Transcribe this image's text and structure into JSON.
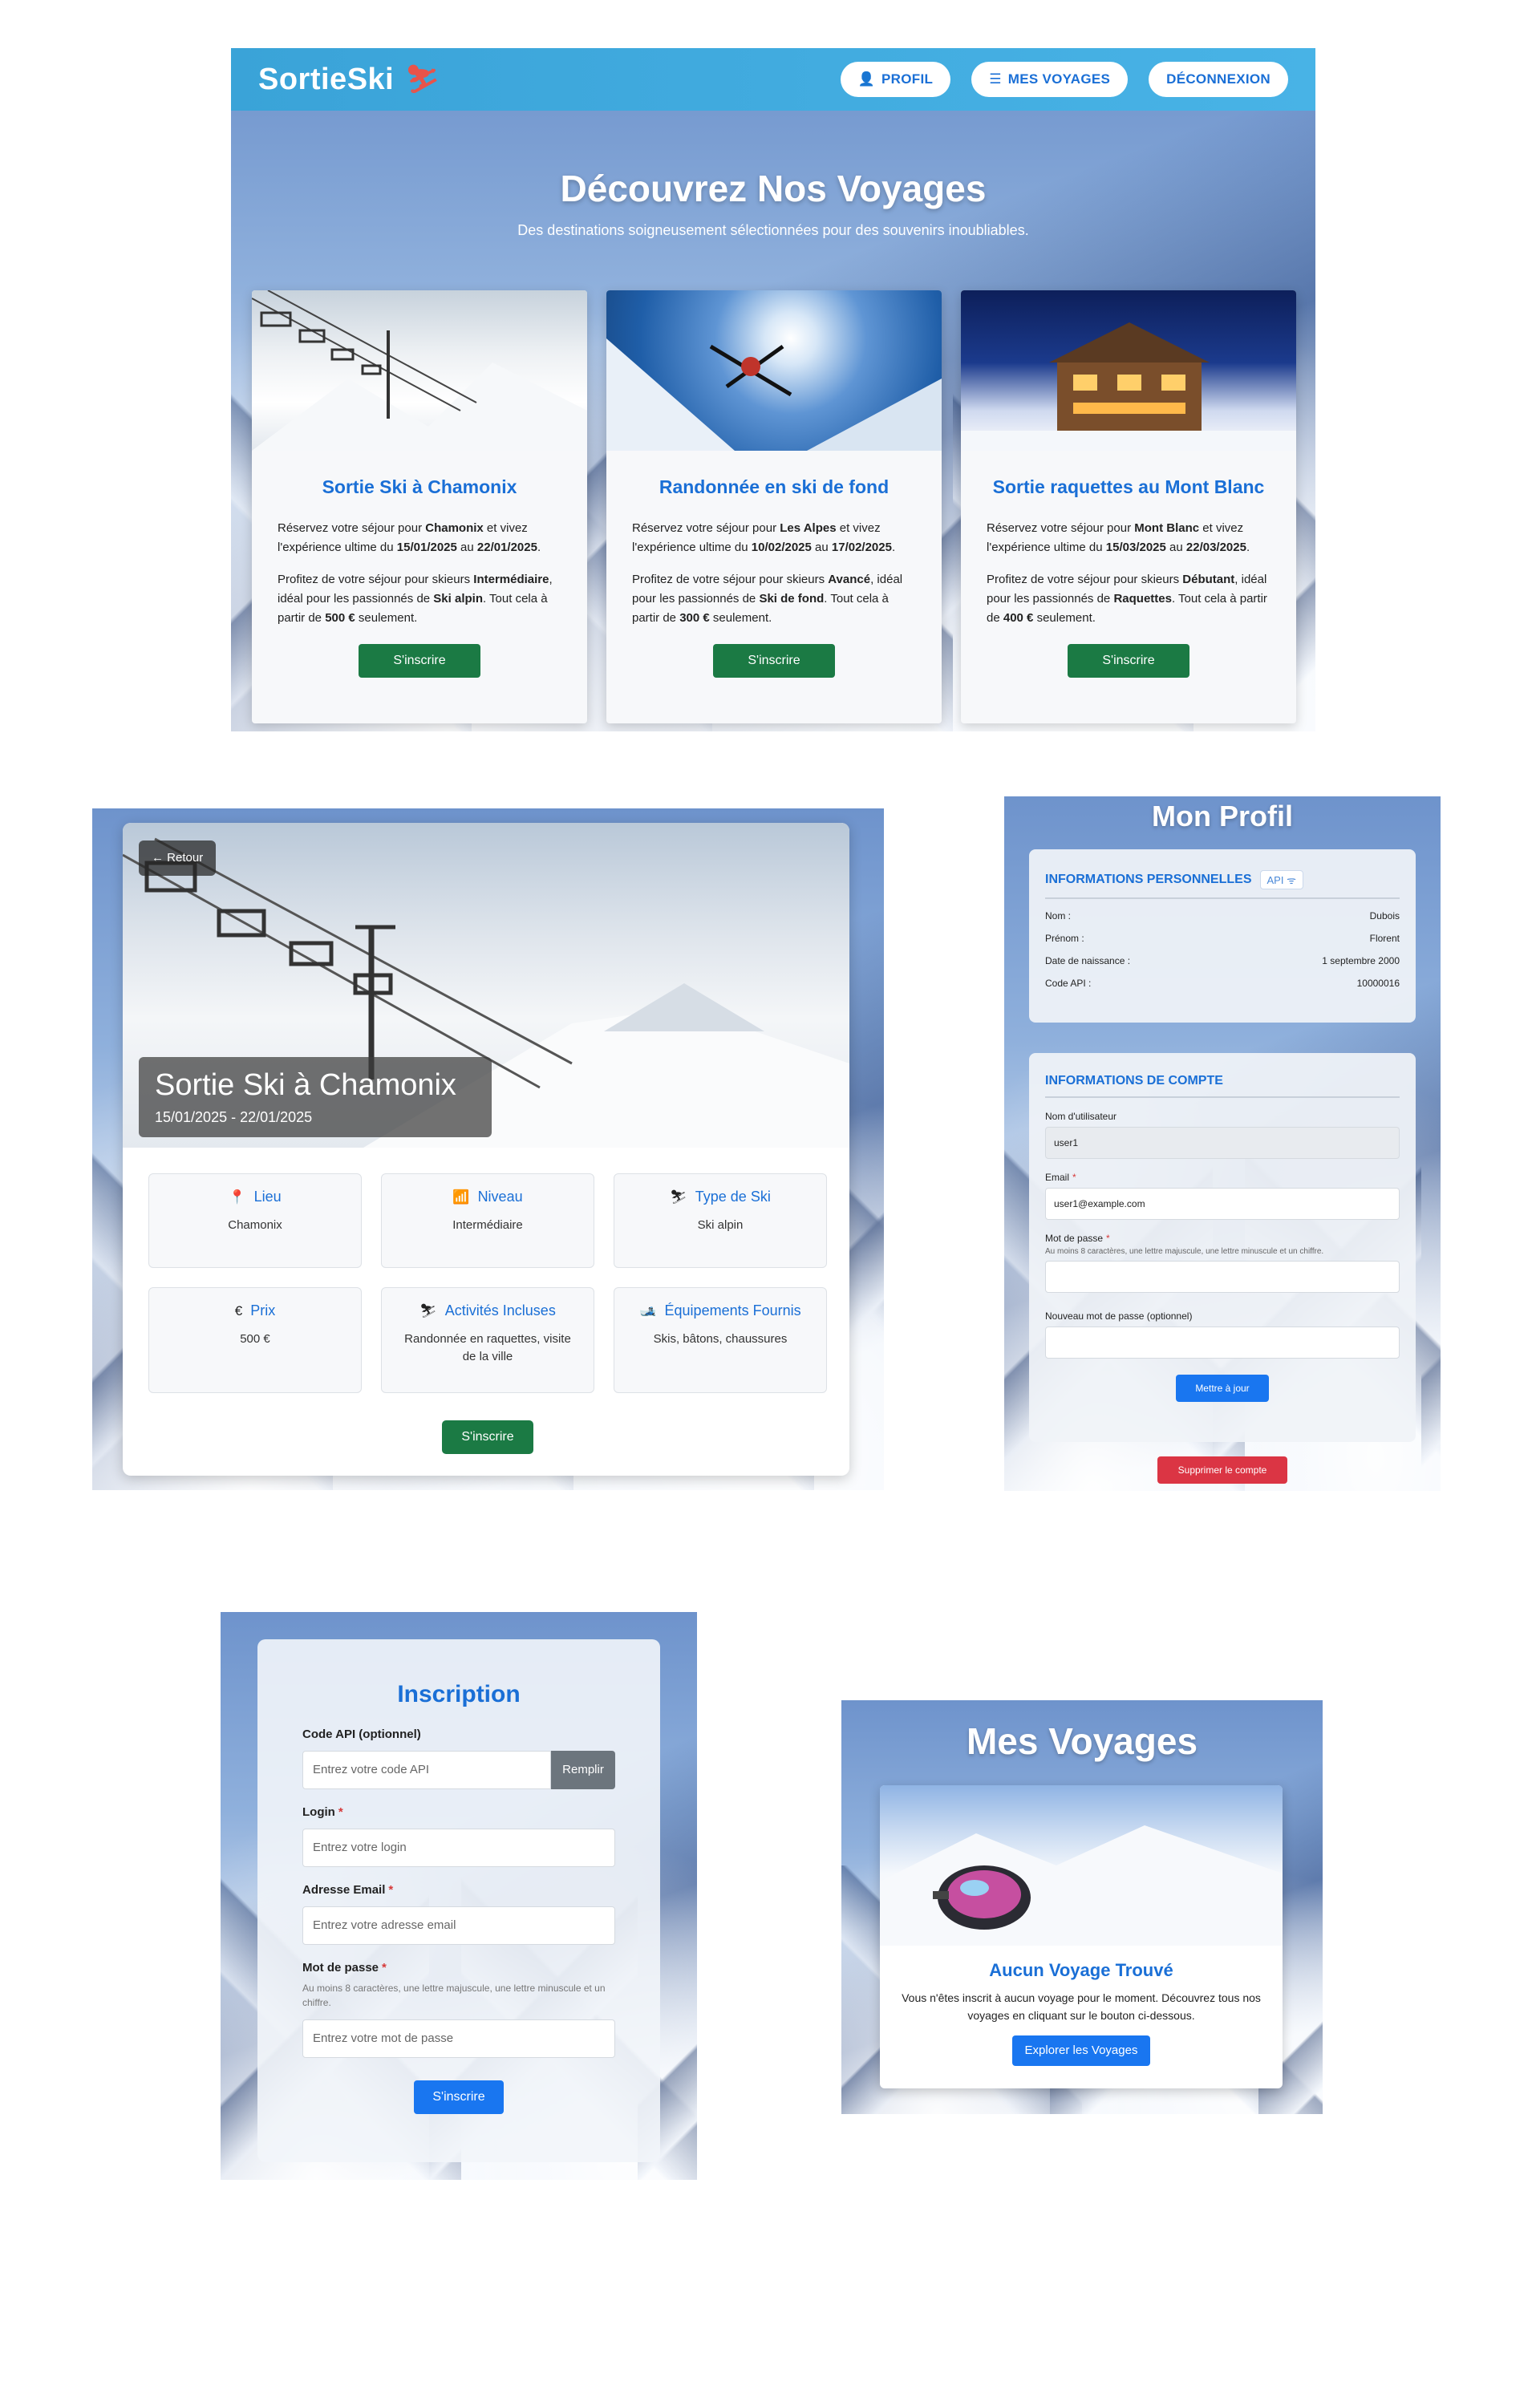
{
  "home": {
    "brand": "SortieSki",
    "nav": {
      "profile": "PROFIL",
      "trips": "MES VOYAGES",
      "logout": "DÉCONNEXION"
    },
    "hero_title": "Découvrez Nos Voyages",
    "hero_subtitle": "Des destinations soigneusement sélectionnées pour des souvenirs inoubliables.",
    "cards": [
      {
        "title": "Sortie Ski à Chamonix",
        "p1_a": "Réservez votre séjour pour ",
        "p1_place": "Chamonix",
        "p1_b": " et vivez l'expérience ultime du ",
        "p1_start": "15/01/2025",
        "p1_c": " au ",
        "p1_end": "22/01/2025",
        "p1_d": ".",
        "p2_a": "Profitez de votre séjour pour skieurs ",
        "p2_level": "Intermédiaire",
        "p2_b": ", idéal pour les passionnés de ",
        "p2_type": "Ski alpin",
        "p2_c": ". Tout cela à partir de ",
        "p2_price": "500 €",
        "p2_d": " seulement.",
        "button": "S'inscrire"
      },
      {
        "title": "Randonnée en ski de fond",
        "p1_a": "Réservez votre séjour pour ",
        "p1_place": "Les Alpes",
        "p1_b": " et vivez l'expérience ultime du ",
        "p1_start": "10/02/2025",
        "p1_c": " au ",
        "p1_end": "17/02/2025",
        "p1_d": ".",
        "p2_a": "Profitez de votre séjour pour skieurs ",
        "p2_level": "Avancé",
        "p2_b": ", idéal pour les passionnés de ",
        "p2_type": "Ski de fond",
        "p2_c": ". Tout cela à partir de ",
        "p2_price": "300 €",
        "p2_d": " seulement.",
        "button": "S'inscrire"
      },
      {
        "title": "Sortie raquettes au Mont Blanc",
        "p1_a": "Réservez votre séjour pour ",
        "p1_place": "Mont Blanc",
        "p1_b": " et vivez l'expérience ultime du ",
        "p1_start": "15/03/2025",
        "p1_c": " au ",
        "p1_end": "22/03/2025",
        "p1_d": ".",
        "p2_a": "Profitez de votre séjour pour skieurs ",
        "p2_level": "Débutant",
        "p2_b": ", idéal pour les passionnés de ",
        "p2_type": "Raquettes",
        "p2_c": ". Tout cela à partir de ",
        "p2_price": "400 €",
        "p2_d": " seulement.",
        "button": "S'inscrire"
      }
    ]
  },
  "detail": {
    "back": "← Retour",
    "title": "Sortie Ski à Chamonix",
    "dates": "15/01/2025 - 22/01/2025",
    "items": [
      {
        "label": "Lieu",
        "icon": "📍",
        "value": "Chamonix"
      },
      {
        "label": "Niveau",
        "icon": "📶",
        "value": "Intermédiaire"
      },
      {
        "label": "Type de Ski",
        "icon": "⛷",
        "value": "Ski alpin"
      },
      {
        "label": "Prix",
        "icon": "€",
        "value": "500 €"
      },
      {
        "label": "Activités Incluses",
        "icon": "⛷",
        "value": "Randonnée en raquettes, visite de la ville"
      },
      {
        "label": "Équipements Fournis",
        "icon": "🎿",
        "value": "Skis, bâtons, chaussures"
      }
    ],
    "button": "S'inscrire"
  },
  "profile": {
    "title": "Mon Profil",
    "personal_heading": "INFORMATIONS PERSONNELLES",
    "api_badge": "API ᯤ",
    "rows": [
      {
        "label": "Nom :",
        "value": "Dubois"
      },
      {
        "label": "Prénom :",
        "value": "Florent"
      },
      {
        "label": "Date de naissance :",
        "value": "1 septembre 2000"
      },
      {
        "label": "Code API :",
        "value": "10000016"
      }
    ],
    "account_heading": "INFORMATIONS DE COMPTE",
    "username_label": "Nom d'utilisateur",
    "username_value": "user1",
    "email_label": "Email",
    "email_value": "user1@example.com",
    "password_label": "Mot de passe",
    "password_hint": "Au moins 8 caractères, une lettre majuscule, une lettre minuscule et un chiffre.",
    "new_password_label": "Nouveau mot de passe (optionnel)",
    "update_button": "Mettre à jour",
    "delete_button": "Supprimer le compte"
  },
  "signup": {
    "title": "Inscription",
    "api_label": "Code API (optionnel)",
    "api_placeholder": "Entrez votre code API",
    "fill_button": "Remplir",
    "login_label": "Login",
    "login_placeholder": "Entrez votre login",
    "email_label": "Adresse Email",
    "email_placeholder": "Entrez votre adresse email",
    "password_label": "Mot de passe",
    "password_hint": "Au moins 8 caractères, une lettre majuscule, une lettre minuscule et un chiffre.",
    "password_placeholder": "Entrez votre mot de passe",
    "submit": "S'inscrire"
  },
  "trips": {
    "title": "Mes Voyages",
    "empty_title": "Aucun Voyage Trouvé",
    "empty_text": "Vous n'êtes inscrit à aucun voyage pour le moment. Découvrez tous nos voyages en cliquant sur le bouton ci-dessous.",
    "button": "Explorer les Voyages"
  },
  "colors": {
    "primary": "#1a6fd6",
    "success": "#1b7a44",
    "danger": "#db3544",
    "nav": "#3aa3d8"
  }
}
